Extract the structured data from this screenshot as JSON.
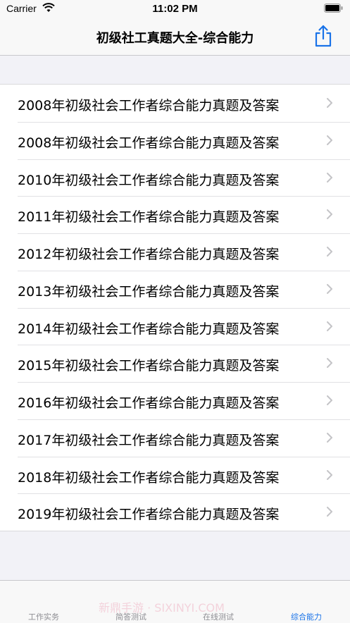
{
  "status": {
    "carrier": "Carrier",
    "time": "11:02 PM"
  },
  "nav": {
    "title": "初级社工真题大全-综合能力"
  },
  "list": {
    "items": [
      "2008年初级社会工作者综合能力真题及答案",
      "2008年初级社会工作者综合能力真题及答案",
      "2010年初级社会工作者综合能力真题及答案",
      "2011年初级社会工作者综合能力真题及答案",
      "2012年初级社会工作者综合能力真题及答案",
      "2013年初级社会工作者综合能力真题及答案",
      "2014年初级社会工作者综合能力真题及答案",
      "2015年初级社会工作者综合能力真题及答案",
      "2016年初级社会工作者综合能力真题及答案",
      "2017年初级社会工作者综合能力真题及答案",
      "2018年初级社会工作者综合能力真题及答案",
      "2019年初级社会工作者综合能力真题及答案"
    ]
  },
  "tabs": [
    {
      "label": "工作实务"
    },
    {
      "label": "简答测试"
    },
    {
      "label": "在线测试"
    },
    {
      "label": "综合能力"
    }
  ],
  "watermark": "新鼎手游 · SIXINYI.COM",
  "colors": {
    "accent": "#1a73e8",
    "tab_inactive": "#8e8e93",
    "background": "#f2f2f7"
  }
}
